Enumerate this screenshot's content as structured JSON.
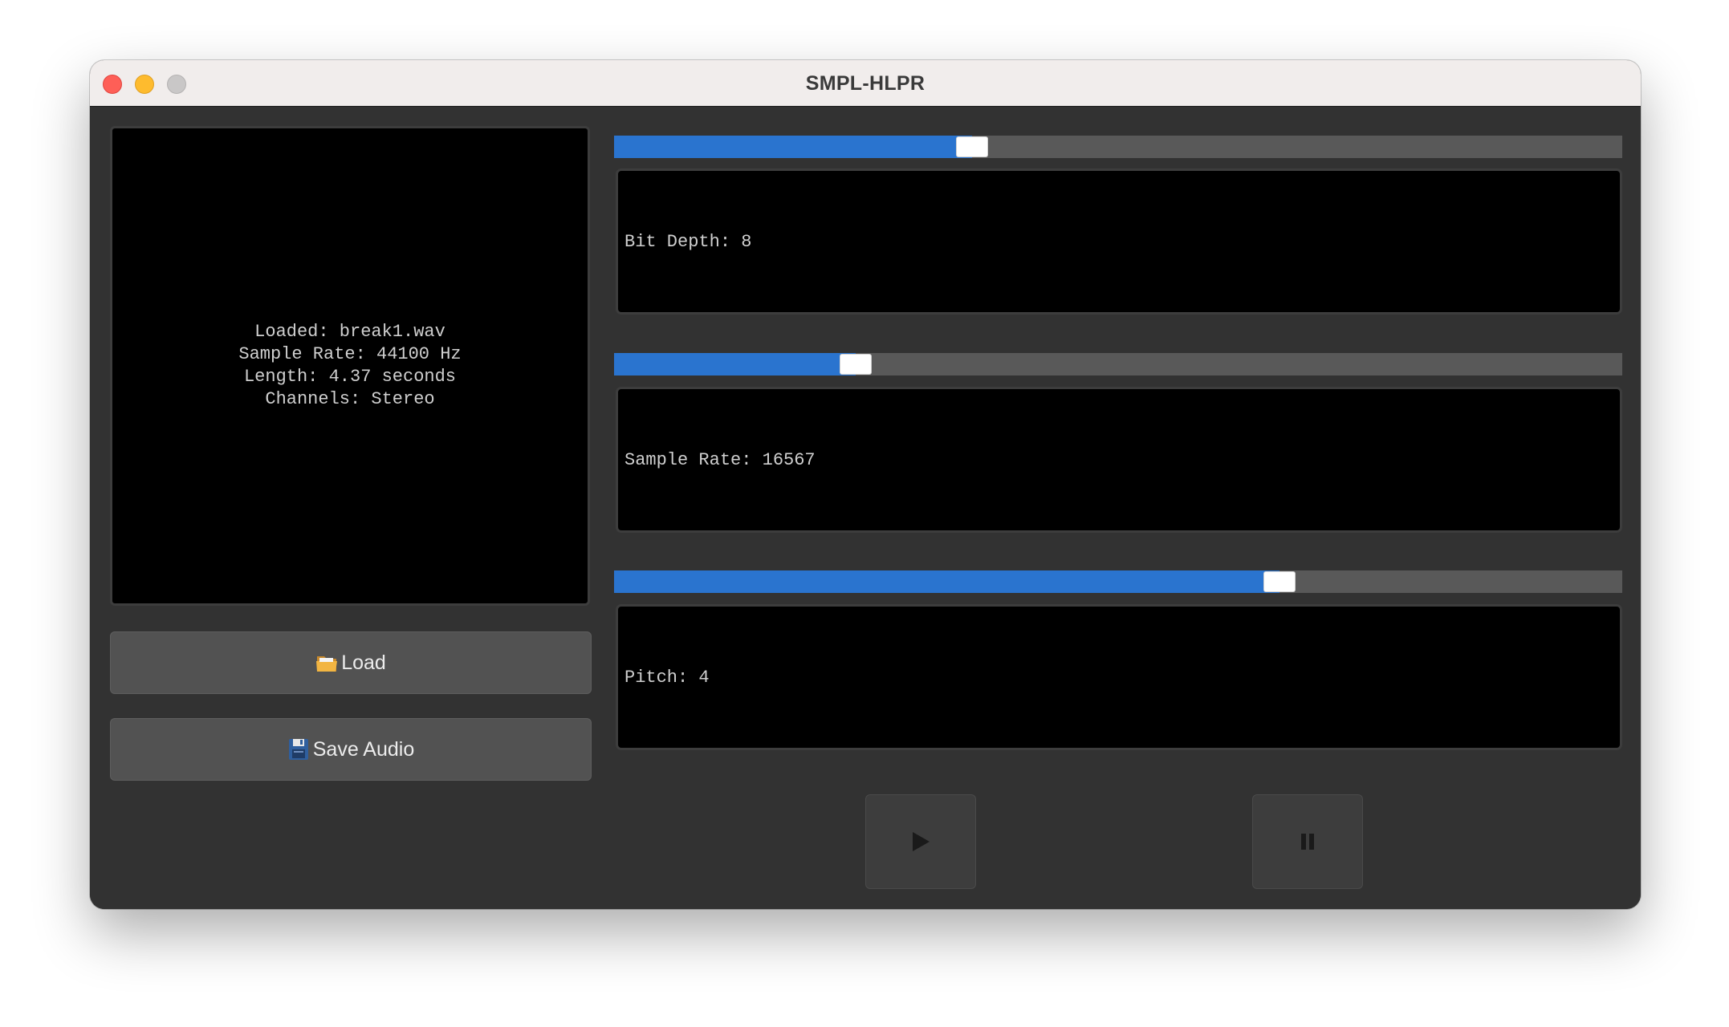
{
  "window": {
    "title": "SMPL-HLPR"
  },
  "file_info": {
    "lines": [
      "Loaded: break1.wav",
      "Sample Rate: 44100 Hz",
      "Length: 4.37 seconds",
      "Channels: Stereo"
    ]
  },
  "buttons": {
    "load": {
      "label": "Load",
      "icon": "folder-icon"
    },
    "save": {
      "label": "Save Audio",
      "icon": "floppy-disk-icon"
    }
  },
  "controls": [
    {
      "name": "bit-depth",
      "label": "Bit Depth: 8",
      "level": 0.355
    },
    {
      "name": "sample-rate",
      "label": "Sample Rate: 16567",
      "level": 0.24
    },
    {
      "name": "pitch",
      "label": "Pitch: 4",
      "level": 0.66
    }
  ],
  "transport": {
    "play_icon": "play-icon",
    "pause_icon": "pause-icon"
  },
  "colors": {
    "slider_fill": "#2a74cf",
    "slider_track": "#595959",
    "panel_bg": "#000000",
    "window_bg": "#323232"
  }
}
